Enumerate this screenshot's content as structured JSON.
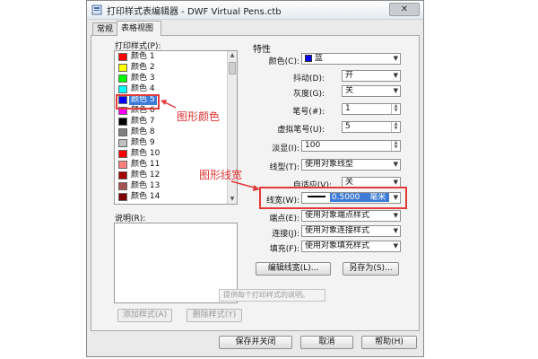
{
  "window": {
    "title": "打印样式表编辑器 - DWF Virtual Pens.ctb",
    "close_glyph": "✕"
  },
  "tabs": [
    {
      "label": "常规"
    },
    {
      "label": "表格视图"
    }
  ],
  "print_styles": {
    "label": "打印样式(P):",
    "items": [
      {
        "label": "颜色 1",
        "color": "#ff0000"
      },
      {
        "label": "颜色 2",
        "color": "#ffff00"
      },
      {
        "label": "颜色 3",
        "color": "#00ff00"
      },
      {
        "label": "颜色 4",
        "color": "#00ffff"
      },
      {
        "label": "颜色 5",
        "color": "#0000ff",
        "selected": true
      },
      {
        "label": "颜色 6",
        "color": "#ff00ff"
      },
      {
        "label": "颜色 7",
        "color": "#000000"
      },
      {
        "label": "颜色 8",
        "color": "#808080"
      },
      {
        "label": "颜色 9",
        "color": "#c0c0c0"
      },
      {
        "label": "颜色 10",
        "color": "#ff0000"
      },
      {
        "label": "颜色 11",
        "color": "#ff7f7f"
      },
      {
        "label": "颜色 12",
        "color": "#a50000"
      },
      {
        "label": "颜色 13",
        "color": "#a55252"
      },
      {
        "label": "颜色 14",
        "color": "#7f0000"
      }
    ]
  },
  "description": {
    "label": "说明(R):",
    "hint": "提供每个打印样式的说明。"
  },
  "left_buttons": {
    "add": "添加样式(A)",
    "delete": "删除样式(Y)"
  },
  "properties": {
    "title": "特性",
    "color": {
      "label": "颜色(C):",
      "value": "蓝",
      "swatch": "#0000ff"
    },
    "dither": {
      "label": "抖动(D):",
      "value": "开"
    },
    "grayscale": {
      "label": "灰度(G):",
      "value": "关"
    },
    "pen": {
      "label": "笔号(#):",
      "value": "1"
    },
    "virtual_pen": {
      "label": "虚拟笔号(U):",
      "value": "5"
    },
    "screening": {
      "label": "淡显(I):",
      "value": "100"
    },
    "linetype": {
      "label": "线型(T):",
      "value": "使用对象线型"
    },
    "adaptive": {
      "label": "自适应(V):",
      "value": "关"
    },
    "lineweight": {
      "label": "线宽(W):",
      "value": "0.5000",
      "unit": "毫米"
    },
    "endpoint": {
      "label": "端点(E):",
      "value": "使用对象端点样式"
    },
    "join": {
      "label": "连接(J):",
      "value": "使用对象连接样式"
    },
    "fill": {
      "label": "填充(F):",
      "value": "使用对象填充样式"
    },
    "edit_lineweights": "编辑线宽(L)...",
    "save_as": "另存为(S)..."
  },
  "annotations": {
    "graphic_color": "图形颜色",
    "graphic_lineweight": "图形线宽",
    "accent": "#e23a3a"
  },
  "footer": {
    "save_close": "保存并关闭",
    "cancel": "取消",
    "help": "帮助(H)"
  }
}
